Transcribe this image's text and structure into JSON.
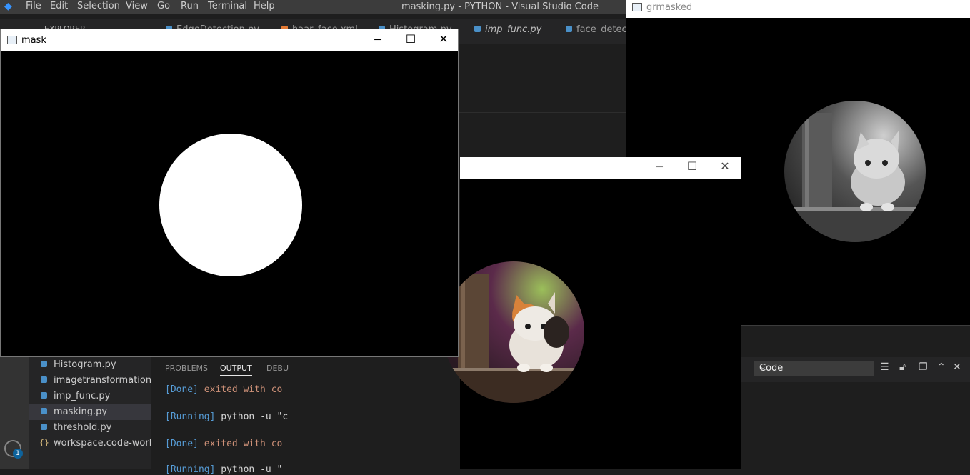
{
  "vscode": {
    "menu": [
      "File",
      "Edit",
      "Selection",
      "View",
      "Go",
      "Run",
      "Terminal",
      "Help"
    ],
    "title": "masking.py - PYTHON - Visual Studio Code",
    "tabs": [
      "EdgeDetection.py",
      "haar_face.xml",
      "Histogram.py",
      "imp_func.py",
      "face_detect."
    ],
    "explorer_label": "EXPLORER",
    "files": [
      "Histogram.py",
      "imagetransformations...",
      "imp_func.py",
      "masking.py",
      "threshold.py",
      "workspace.code-work..."
    ],
    "panel_tabs": [
      "PROBLEMS",
      "OUTPUT",
      "DEBU"
    ],
    "output_lines": [
      {
        "bracket": "[Done]",
        "text": " exited with ",
        "tail": "co"
      },
      {
        "bracket": "[Running]",
        "text": " python -u \"",
        "tail": "c"
      },
      {
        "bracket": "[Done]",
        "text": " exited with ",
        "tail": "co"
      },
      {
        "bracket": "[Running]",
        "text": " python -u \"",
        "tail": ""
      }
    ],
    "output_select": "Code",
    "accounts_badge": "1"
  },
  "windows": {
    "mask": {
      "title": "mask"
    },
    "masked": {
      "title": ""
    },
    "grmasked": {
      "title": "grmasked"
    }
  }
}
